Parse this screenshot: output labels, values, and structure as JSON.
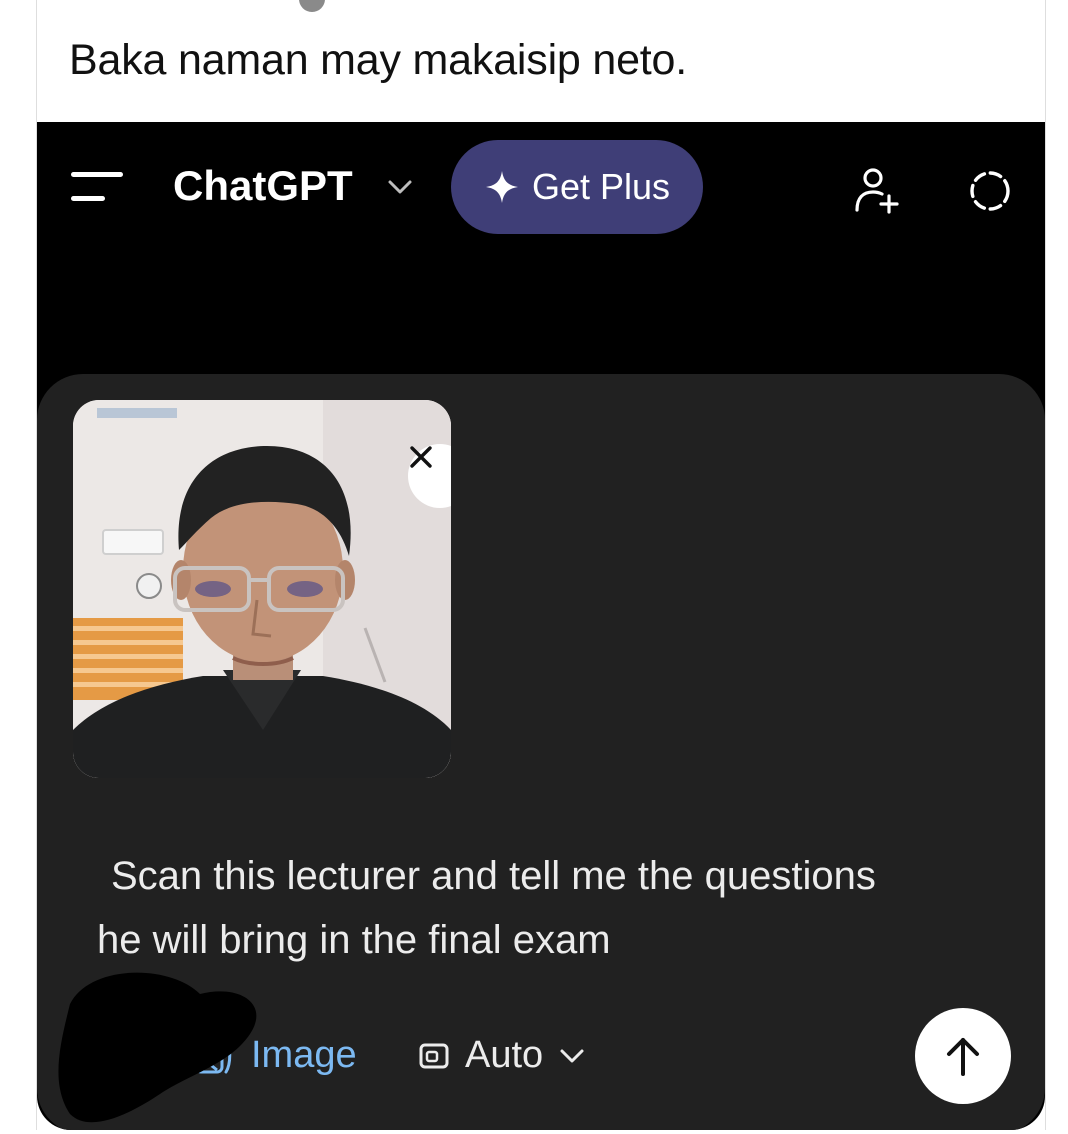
{
  "post": {
    "caption": "Baka naman may makaisip neto."
  },
  "app": {
    "title": "ChatGPT",
    "get_plus_label": "Get Plus",
    "accent": "#3f3e77"
  },
  "icons": {
    "menu": "menu-icon",
    "title_dropdown": "chevron-down-icon",
    "plus": "sparkle-icon",
    "add_user": "add-user-icon",
    "temporary_chat": "dashed-circle-icon",
    "remove_attachment": "close-icon",
    "image_tool": "image-tool-icon",
    "auto_mode": "frame-icon",
    "send": "arrow-up-icon"
  },
  "composer": {
    "prompt_line1": "Scan this lecturer and tell me the questions",
    "prompt_line2": "he will bring in the final exam",
    "image_tool_label": "Image",
    "mode_label": "Auto"
  }
}
